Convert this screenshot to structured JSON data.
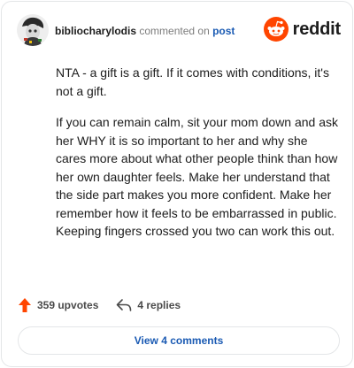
{
  "header": {
    "username": "bibliocharylodis",
    "action_text": "commented on",
    "post_link": "post",
    "brand_name": "reddit"
  },
  "comment": {
    "paragraphs": [
      "NTA - a gift is a gift. If it comes with conditions, it's not a gift.",
      "If you can remain calm, sit your mom down and ask her WHY it is so important to her and why she cares more about what other people think than how her own daughter feels. Make her understand that the side part makes you more confident. Make her remember how it feels to be embarrassed in public. Keeping fingers crossed you two can work this out."
    ]
  },
  "actions": {
    "upvotes": "359 upvotes",
    "replies": "4 replies"
  },
  "view_comments_label": "View 4 comments",
  "icons": {
    "avatar": "user-avatar",
    "brand": "reddit-snoo-icon",
    "upvote": "upvote-arrow-icon",
    "reply": "reply-arrow-icon"
  },
  "colors": {
    "brand": "#ff4500",
    "link": "#1a5ab3",
    "upvote": "#ff4500",
    "muted": "#7c7c7c"
  }
}
